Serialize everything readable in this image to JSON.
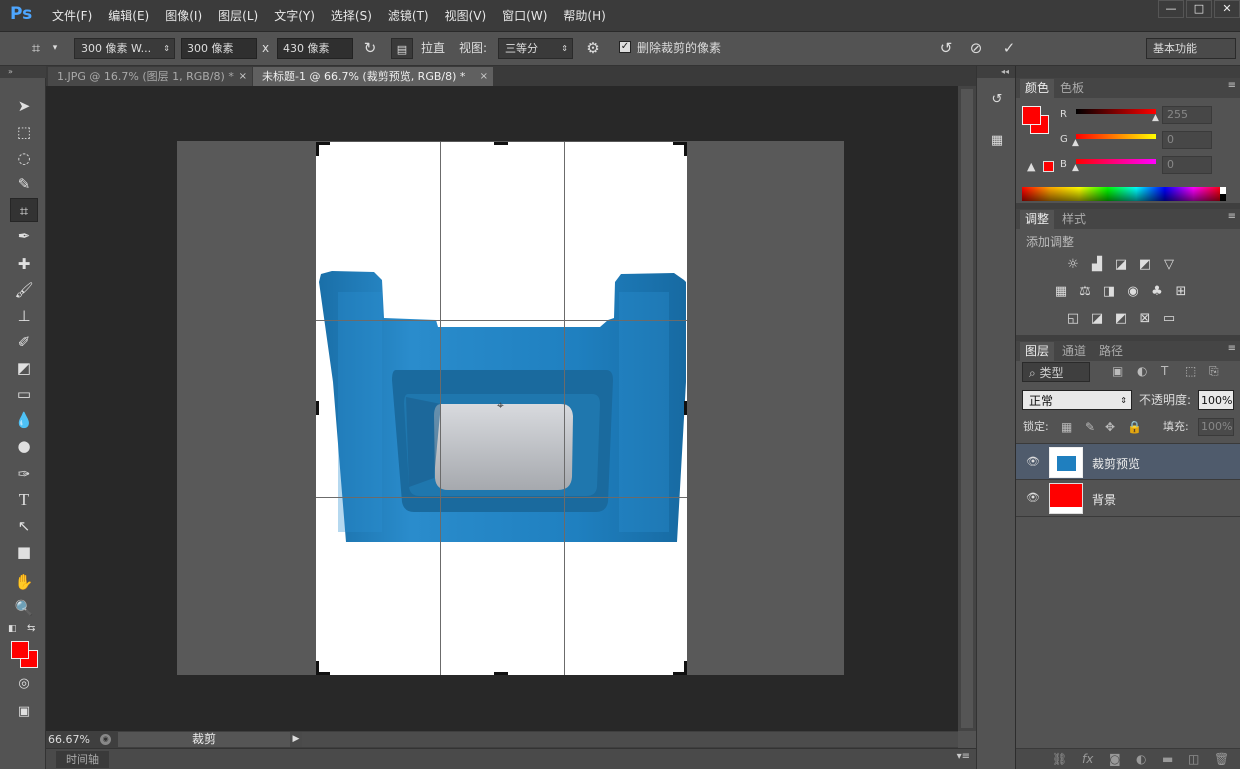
{
  "app": {
    "logo": "Ps",
    "menus": [
      "文件(F)",
      "编辑(E)",
      "图像(I)",
      "图层(L)",
      "文字(Y)",
      "选择(S)",
      "滤镜(T)",
      "视图(V)",
      "窗口(W)",
      "帮助(H)"
    ],
    "window_controls": [
      "—",
      "□",
      "✕"
    ]
  },
  "options": {
    "preset": "300 像素 W...",
    "width_value": "300 像素",
    "times": "x",
    "height_value": "430 像素",
    "straighten_label": "拉直",
    "view_label": "视图:",
    "view_value": "三等分",
    "delete_pixels_label": "删除裁剪的像素",
    "workspace": "基本功能"
  },
  "documents": {
    "tabs": [
      {
        "label": "1.JPG @ 16.7% (图层 1, RGB/8) *",
        "close": "×"
      },
      {
        "label": "未标题-1 @ 66.7% (裁剪预览, RGB/8) *",
        "close": "×"
      }
    ]
  },
  "status": {
    "zoom": "66.67%",
    "tool_info": "裁剪"
  },
  "timeline": {
    "label": "时间轴"
  },
  "color_panel": {
    "tabs": [
      "颜色",
      "色板"
    ],
    "channels": [
      {
        "label": "R",
        "value": "255"
      },
      {
        "label": "G",
        "value": "0"
      },
      {
        "label": "B",
        "value": "0"
      }
    ],
    "foreground": "#ff0000",
    "background": "#ff0000"
  },
  "adjustments_panel": {
    "tabs": [
      "调整",
      "样式"
    ],
    "title": "添加调整"
  },
  "layers_panel": {
    "tabs": [
      "图层",
      "通道",
      "路径"
    ],
    "filter_label": "类型",
    "blend_mode": "正常",
    "opacity_label": "不透明度:",
    "opacity_value": "100%",
    "lock_label": "锁定:",
    "fill_label": "填充:",
    "fill_value": "100%",
    "layers": [
      {
        "name": "裁剪预览",
        "selected": true
      },
      {
        "name": "背景",
        "selected": false
      }
    ]
  },
  "colors": {
    "accent": "#4da6ff",
    "product_blue": "#1f7fbf",
    "foreground_red": "#ff0000"
  }
}
